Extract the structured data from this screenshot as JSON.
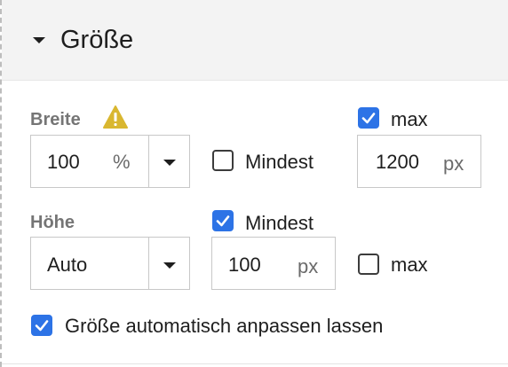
{
  "section": {
    "title": "Größe",
    "icons": {
      "toggle": "caret-down-icon"
    }
  },
  "width": {
    "label": "Breite",
    "warning_icon": "warning-icon",
    "value": "100",
    "unit": "%",
    "min_label": "Mindest",
    "min_checked": false,
    "max_label": "max",
    "max_checked": true,
    "max_value": "1200",
    "max_unit": "px"
  },
  "height": {
    "label": "Höhe",
    "value": "Auto",
    "min_label": "Mindest",
    "min_checked": true,
    "min_value": "100",
    "min_unit": "px",
    "max_label": "max",
    "max_checked": false
  },
  "auto_size": {
    "label": "Größe automatisch anpassen lassen",
    "checked": true
  },
  "colors": {
    "accent": "#2d73e6",
    "warning": "#d9b730",
    "header_bg": "#f3f3f3"
  }
}
